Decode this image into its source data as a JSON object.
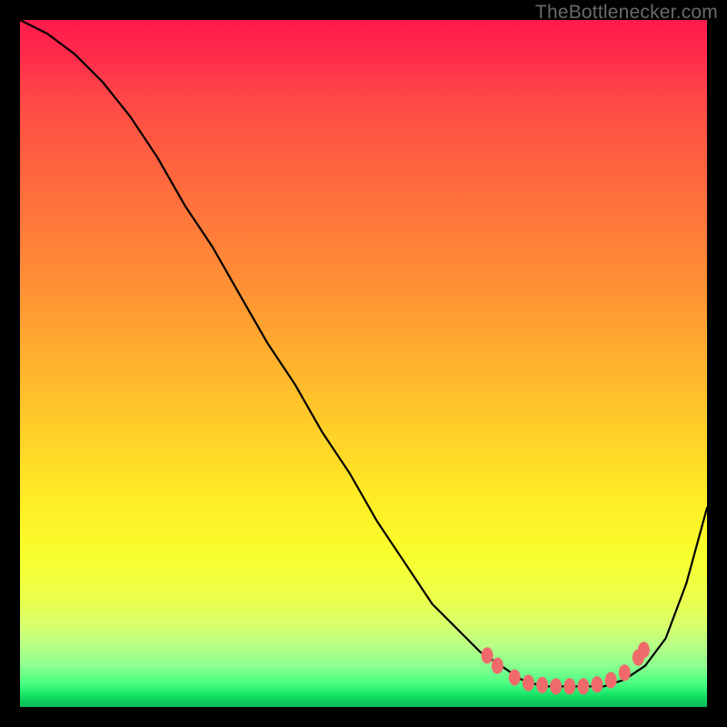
{
  "watermark": "TheBottlenecker.com",
  "chart_data": {
    "type": "line",
    "title": "",
    "xlabel": "",
    "ylabel": "",
    "xlim": [
      0,
      100
    ],
    "ylim": [
      0,
      100
    ],
    "grid": false,
    "series": [
      {
        "name": "curve",
        "x": [
          0,
          4,
          8,
          12,
          16,
          20,
          24,
          28,
          32,
          36,
          40,
          44,
          48,
          52,
          56,
          60,
          64,
          67,
          70,
          73,
          76,
          79,
          82,
          85,
          88,
          91,
          94,
          97,
          100
        ],
        "y": [
          100,
          98,
          95,
          91,
          86,
          80,
          73,
          67,
          60,
          53,
          47,
          40,
          34,
          27,
          21,
          15,
          11,
          8,
          6,
          4,
          3,
          3,
          3,
          3,
          4,
          6,
          10,
          18,
          29
        ]
      }
    ],
    "markers": {
      "name": "highlight-dots",
      "color": "#ef6b6b",
      "points": [
        {
          "x": 68,
          "y": 7.5
        },
        {
          "x": 69.5,
          "y": 6
        },
        {
          "x": 72,
          "y": 4.3
        },
        {
          "x": 74,
          "y": 3.5
        },
        {
          "x": 76,
          "y": 3.2
        },
        {
          "x": 78,
          "y": 3.0
        },
        {
          "x": 80,
          "y": 3.0
        },
        {
          "x": 82,
          "y": 3.0
        },
        {
          "x": 84,
          "y": 3.3
        },
        {
          "x": 86,
          "y": 3.9
        },
        {
          "x": 88,
          "y": 5.0
        },
        {
          "x": 90,
          "y": 7.2
        },
        {
          "x": 90.8,
          "y": 8.3
        }
      ]
    },
    "background_gradient": {
      "top": "#ff1a4d",
      "mid": "#ffed25",
      "bottom": "#06bb55"
    }
  }
}
